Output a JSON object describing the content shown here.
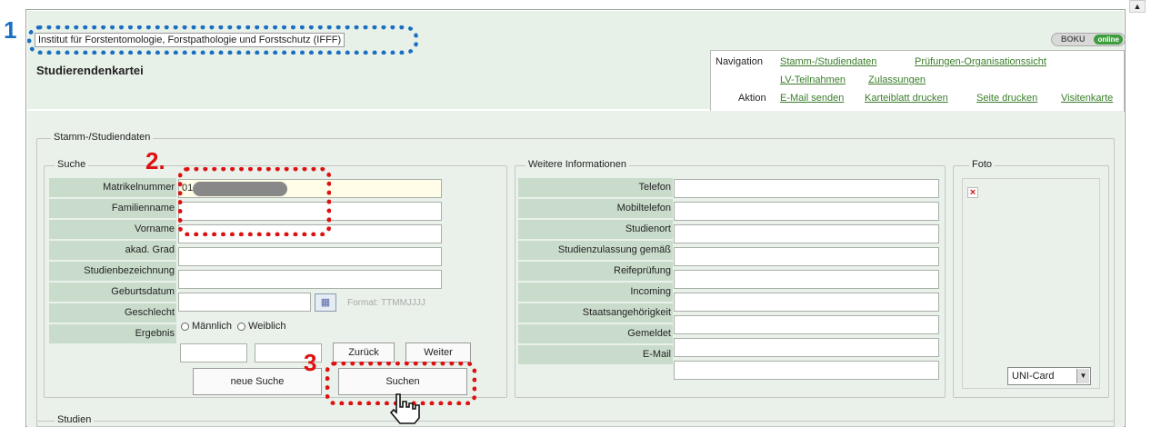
{
  "header": {
    "institute": "Institut für Forstentomologie, Forstpathologie und Forstschutz (IFFF)",
    "title": "Studierendenkartei",
    "boku_label": "BOKU",
    "boku_online": "online"
  },
  "nav": {
    "navigation_label": "Navigation",
    "aktion_label": "Aktion",
    "links": [
      "Stamm-/Studiendaten",
      "Prüfungen-Organisationssicht",
      "LV-Teilnahmen",
      "Zulassungen"
    ],
    "actions": [
      "E-Mail senden",
      "Karteiblatt drucken",
      "Seite drucken",
      "Visitenkarte"
    ]
  },
  "section": {
    "stamm": "Stamm-/Studiendaten",
    "suche": "Suche",
    "weitere": "Weitere Informationen",
    "foto": "Foto",
    "studien": "Studien"
  },
  "search": {
    "labels": [
      "Matrikelnummer",
      "Familienname",
      "Vorname",
      "akad. Grad",
      "Studienbezeichnung",
      "Geburtsdatum"
    ],
    "matrikel_value": "01",
    "format_hint": "Format: TTMMJJJJ",
    "geschlecht": "Geschlecht",
    "maennlich": "Männlich",
    "weiblich": "Weiblich",
    "ergebnis": "Ergebnis",
    "zurueck": "Zurück",
    "weiter": "Weiter",
    "neue_suche": "neue Suche",
    "suchen": "Suchen"
  },
  "info": {
    "labels": [
      "Telefon",
      "Mobiltelefon",
      "Studienort",
      "Studienzulassung gemäß",
      "Reifeprüfung",
      "Incoming",
      "Staatsangehörigkeit",
      "Gemeldet",
      "E-Mail"
    ]
  },
  "photo": {
    "select_value": "UNI-Card"
  },
  "annotations": {
    "n1": "1",
    "n2": "2.",
    "n3": "3"
  },
  "colors": {
    "annotation_red": "#d11111",
    "annotation_blue": "#1a6fc2",
    "label_bg": "#c9dccb",
    "link_green": "#3a7d2a"
  }
}
